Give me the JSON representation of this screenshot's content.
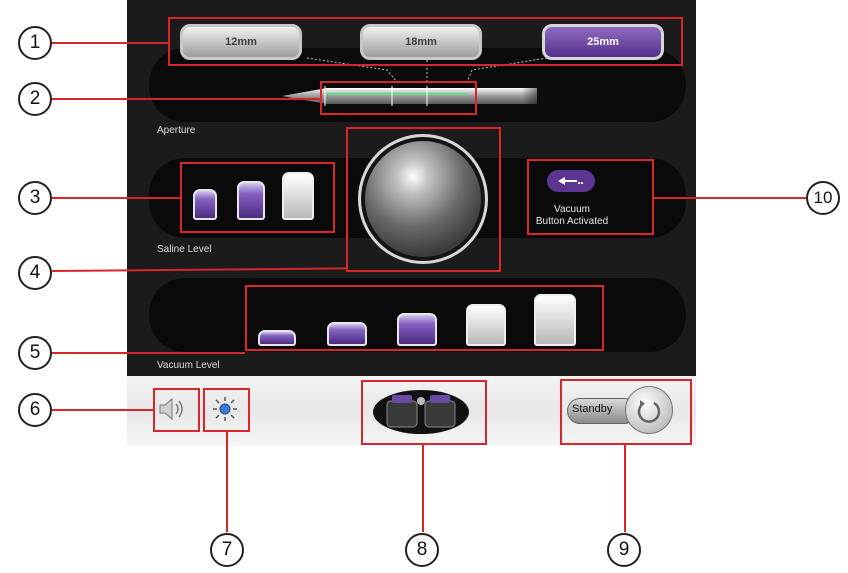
{
  "aperture": {
    "label": "Aperture",
    "options": [
      {
        "label": "12mm",
        "selected": false
      },
      {
        "label": "18mm",
        "selected": false
      },
      {
        "label": "25mm",
        "selected": true
      }
    ]
  },
  "saline": {
    "label": "Saline Level",
    "level": 2,
    "max": 3
  },
  "vacuum_level": {
    "label": "Vacuum Level",
    "level": 3,
    "max": 5
  },
  "vacuum_status": {
    "line1": "Vacuum",
    "line2": "Button Activated",
    "icon": "vacuum-arrow-icon"
  },
  "bottom_bar": {
    "volume_icon": "speaker-icon",
    "brightness_icon": "sun-icon",
    "footswitch_icon": "footswitch-icon",
    "standby_label": "Standby"
  },
  "callouts": [
    "1",
    "2",
    "3",
    "4",
    "5",
    "6",
    "7",
    "8",
    "9",
    "10"
  ],
  "colors": {
    "accent": "#5b3590",
    "annotation": "#d9262a",
    "screen_bg": "#1b1b1b"
  }
}
